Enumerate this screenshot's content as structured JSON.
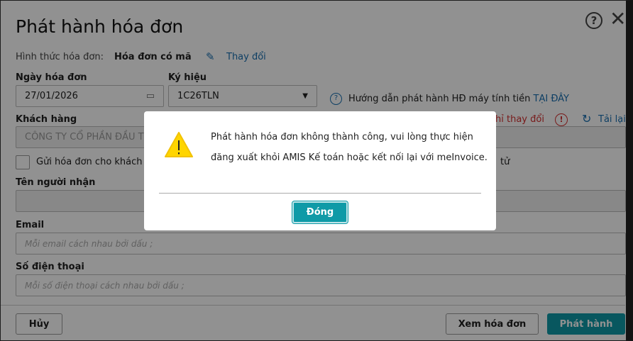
{
  "dialog": {
    "title": "Phát hành hóa đơn",
    "invoice_type_label": "Hình thức hóa đơn:",
    "invoice_type_value": "Hóa đơn có mã",
    "change_link": "Thay đổi",
    "date_label": "Ngày hóa đơn",
    "date_value": "27/01/2026",
    "symbol_label": "Ký hiệu",
    "symbol_value": "1C26TLN",
    "guide_text": "Hướng dẫn phát hành HĐ máy tính tiền",
    "guide_link": "TẠI ĐÂY",
    "customer_label": "Khách hàng",
    "customer_value": "CÔNG TY CỔ PHẦN ĐẦU T",
    "changed_warning": "hỉ thay đổi",
    "reload": "Tải lại",
    "send_checkbox_label": "Gửi hóa đơn cho khách",
    "send_suffix": "tử",
    "recipient_label": "Tên người nhận",
    "email_label": "Email",
    "email_placeholder": "Mỗi email cách nhau bởi dấu ;",
    "phone_label": "Số điện thoại",
    "phone_placeholder": "Mỗi số điện thoại cách nhau bởi dấu ;",
    "cancel": "Hủy",
    "view_invoice": "Xem hóa đơn",
    "issue": "Phát hành"
  },
  "alert": {
    "message": "Phát hành hóa đơn không thành công, vui lòng thực hiện đăng xuất khỏi AMIS Kế toán hoặc kết nối lại với meInvoice.",
    "close": "Đóng"
  }
}
